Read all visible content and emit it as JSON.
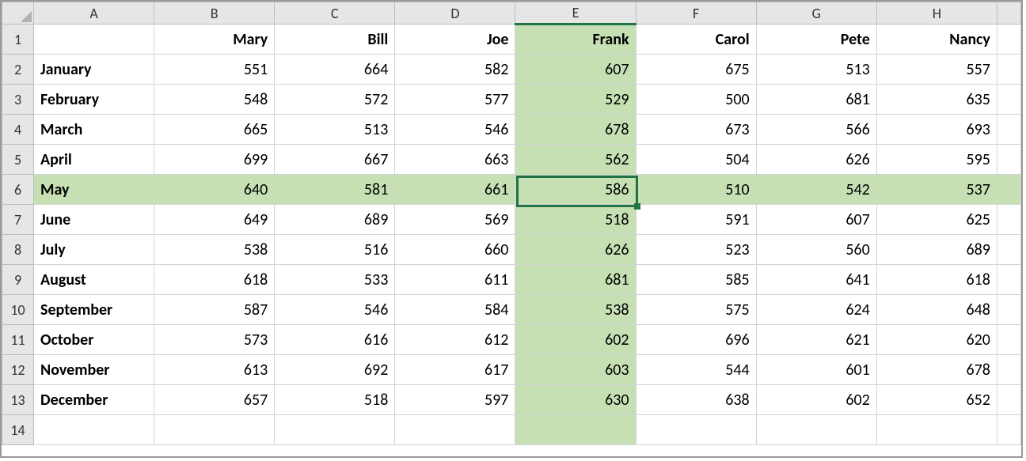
{
  "columns": [
    "A",
    "B",
    "C",
    "D",
    "E",
    "F",
    "G",
    "H"
  ],
  "rowNumbers": [
    "1",
    "2",
    "3",
    "4",
    "5",
    "6",
    "7",
    "8",
    "9",
    "10",
    "11",
    "12",
    "13",
    "14"
  ],
  "headers": [
    "",
    "Mary",
    "Bill",
    "Joe",
    "Frank",
    "Carol",
    "Pete",
    "Nancy"
  ],
  "rows": [
    {
      "label": "January",
      "vals": [
        "551",
        "664",
        "582",
        "607",
        "675",
        "513",
        "557"
      ]
    },
    {
      "label": "February",
      "vals": [
        "548",
        "572",
        "577",
        "529",
        "500",
        "681",
        "635"
      ]
    },
    {
      "label": "March",
      "vals": [
        "665",
        "513",
        "546",
        "678",
        "673",
        "566",
        "693"
      ]
    },
    {
      "label": "April",
      "vals": [
        "699",
        "667",
        "663",
        "562",
        "504",
        "626",
        "595"
      ]
    },
    {
      "label": "May",
      "vals": [
        "640",
        "581",
        "661",
        "586",
        "510",
        "542",
        "537"
      ]
    },
    {
      "label": "June",
      "vals": [
        "649",
        "689",
        "569",
        "518",
        "591",
        "607",
        "625"
      ]
    },
    {
      "label": "July",
      "vals": [
        "538",
        "516",
        "660",
        "626",
        "523",
        "560",
        "689"
      ]
    },
    {
      "label": "August",
      "vals": [
        "618",
        "533",
        "611",
        "681",
        "585",
        "641",
        "618"
      ]
    },
    {
      "label": "September",
      "vals": [
        "587",
        "546",
        "584",
        "538",
        "575",
        "624",
        "648"
      ]
    },
    {
      "label": "October",
      "vals": [
        "573",
        "616",
        "612",
        "602",
        "696",
        "621",
        "620"
      ]
    },
    {
      "label": "November",
      "vals": [
        "613",
        "692",
        "617",
        "603",
        "544",
        "601",
        "678"
      ]
    },
    {
      "label": "December",
      "vals": [
        "657",
        "518",
        "597",
        "630",
        "638",
        "602",
        "652"
      ]
    }
  ],
  "activeCell": {
    "row": 6,
    "col": "E"
  },
  "highlightRow": 6,
  "highlightCol": "E",
  "colors": {
    "highlight": "#c6e0b4",
    "selectBorder": "#217346",
    "gridline": "#d4d4d4",
    "headerBg": "#e6e6e6"
  }
}
